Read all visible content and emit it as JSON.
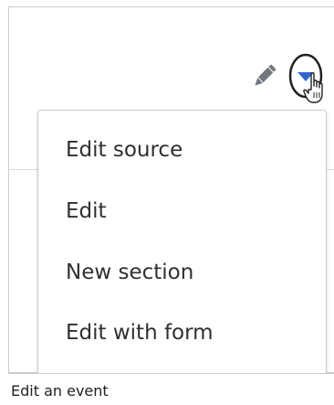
{
  "toolbar": {
    "edit_icon": "pencil-icon",
    "dropdown_icon": "triangle-down-icon",
    "cursor_icon": "hand-pointer-icon"
  },
  "menu": {
    "items": [
      {
        "label": "Edit source"
      },
      {
        "label": "Edit"
      },
      {
        "label": "New section"
      },
      {
        "label": "Edit with form"
      }
    ]
  },
  "caption": {
    "text": "Edit an event"
  },
  "colors": {
    "icon": "#72777d",
    "dropdown_arrow": "#36c",
    "highlight_circle": "#202122",
    "border": "#c8ccd1",
    "menu_text": "#303030"
  }
}
